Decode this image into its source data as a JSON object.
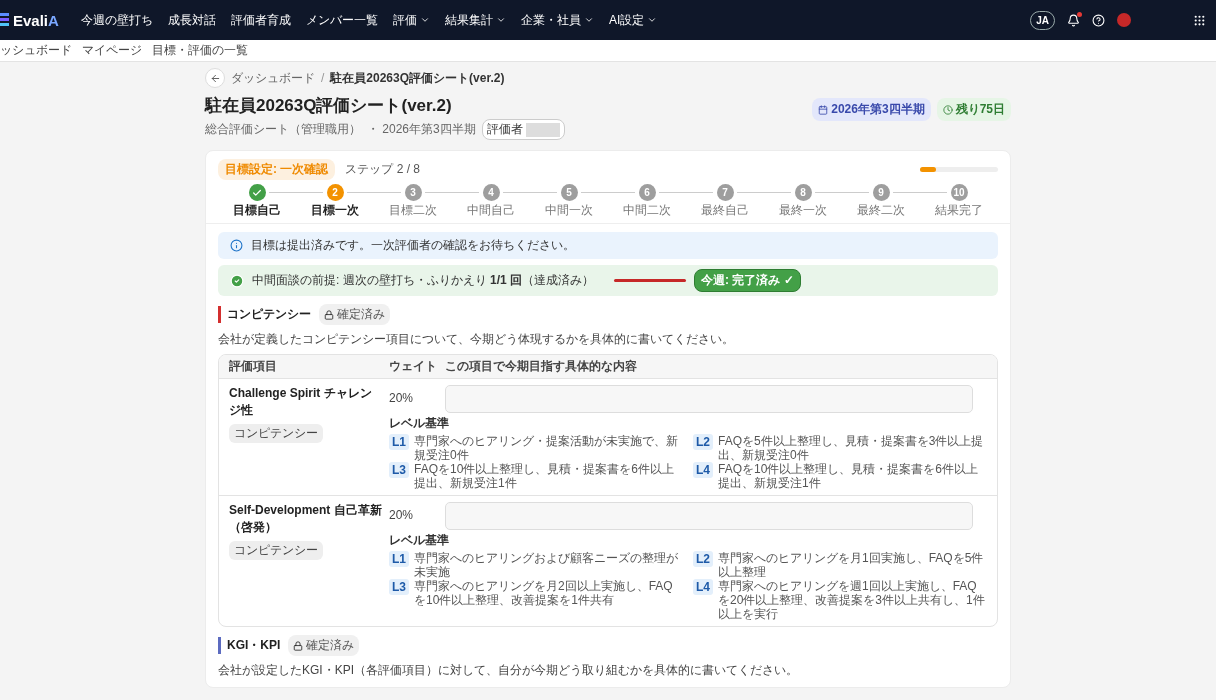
{
  "header": {
    "logo": {
      "text": "Evali",
      "accent": "A"
    },
    "nav": [
      {
        "label": "今週の壁打ち",
        "has_menu": false
      },
      {
        "label": "成長対話",
        "has_menu": false
      },
      {
        "label": "評価者育成",
        "has_menu": false
      },
      {
        "label": "メンバー一覧",
        "has_menu": false
      },
      {
        "label": "評価",
        "has_menu": true
      },
      {
        "label": "結果集計",
        "has_menu": true
      },
      {
        "label": "企業・社員",
        "has_menu": true
      },
      {
        "label": "AI設定",
        "has_menu": true
      }
    ],
    "language": "JA",
    "notifications": true
  },
  "subnav": [
    "ッシュボード",
    "マイページ",
    "目標・評価の一覧"
  ],
  "breadcrumb": [
    "ダッシュボード",
    "駐在員20263Q評価シート(ver.2)"
  ],
  "breadcrumb_separator": "/",
  "title": "駐在員20263Q評価シート(ver.2)",
  "subtitle": "総合評価シート（管理職用）",
  "period": "・ 2026年第3四半期",
  "evaluator_label": "評価者",
  "badges": [
    {
      "kind": "period",
      "text": "2026年第3四半期"
    },
    {
      "kind": "remaining",
      "text": "残り75日"
    }
  ],
  "progress": {
    "phase": "目標設定: 一次確認",
    "step": "ステップ 2 / 8",
    "level": 0.2,
    "steps": [
      {
        "label": "目標自己",
        "done": true,
        "current": false
      },
      {
        "number": "2",
        "label": "目標一次",
        "done": false,
        "current": true
      },
      {
        "number": "3",
        "label": "目標二次",
        "done": false,
        "current": false
      },
      {
        "number": "4",
        "label": "中間自己",
        "done": false,
        "current": false
      },
      {
        "number": "5",
        "label": "中間一次",
        "done": false,
        "current": false
      },
      {
        "number": "6",
        "label": "中間二次",
        "done": false,
        "current": false
      },
      {
        "number": "7",
        "label": "最終自己",
        "done": false,
        "current": false
      },
      {
        "number": "8",
        "label": "最終一次",
        "done": false,
        "current": false
      },
      {
        "number": "9",
        "label": "最終二次",
        "done": false,
        "current": false
      },
      {
        "number": "10",
        "label": "結果完了",
        "done": false,
        "current": false
      }
    ]
  },
  "notice": "目標は提出済みです。一次評価者の確認をお待ちください。",
  "requirement": {
    "text": "中間面談の前提: 週次の壁打ち・ふりかえり **1/1 回**（達成済み）",
    "badge": "今週: 完了済み ✓",
    "done": true
  },
  "sections": [
    {
      "title": "コンピテンシー",
      "color": "#d32f2f",
      "locked": true,
      "lock_label": "確定済み",
      "description": "会社が定義したコンピテンシー項目について、今期どう体現するかを具体的に書いてください。",
      "table": {
        "columns": [
          "評価項目",
          "ウェイト",
          "この項目で今期目指す具体的な内容"
        ],
        "rows": [
          {
            "name": "Challenge Spirit チャレンジ性",
            "tag": "コンピテンシー",
            "weight": "20%",
            "level_heading": "レベル基準",
            "levels": [
              {
                "level": "L1",
                "text": "専門家へのヒアリング・提案活動が未実施で、新規受注0件"
              },
              {
                "level": "L2",
                "text": "FAQを5件以上整理し、見積・提案書を3件以上提出、新規受注0件"
              },
              {
                "level": "L3",
                "text": "FAQを10件以上整理し、見積・提案書を6件以上提出、新規受注1件"
              },
              {
                "level": "L4",
                "text": "FAQを10件以上整理し、見積・提案書を6件以上提出、新規受注1件"
              }
            ]
          },
          {
            "name": "Self-Development 自己革新（啓発）",
            "tag": "コンピテンシー",
            "weight": "20%",
            "level_heading": "レベル基準",
            "levels": [
              {
                "level": "L1",
                "text": "専門家へのヒアリングおよび顧客ニーズの整理が未実施"
              },
              {
                "level": "L2",
                "text": "専門家へのヒアリングを月1回実施し、FAQを5件以上整理"
              },
              {
                "level": "L3",
                "text": "専門家へのヒアリングを月2回以上実施し、FAQを10件以上整理、改善提案を1件共有"
              },
              {
                "level": "L4",
                "text": "専門家へのヒアリングを週1回以上実施し、FAQを20件以上整理、改善提案を3件以上共有し、1件以上を実行"
              }
            ]
          }
        ]
      }
    },
    {
      "title": "KGI・KPI",
      "color": "#5c6bc0",
      "locked": true,
      "lock_label": "確定済み",
      "description": "会社が設定したKGI・KPI（各評価項目）に対して、自分が今期どう取り組むかを具体的に書いてください。"
    }
  ]
}
